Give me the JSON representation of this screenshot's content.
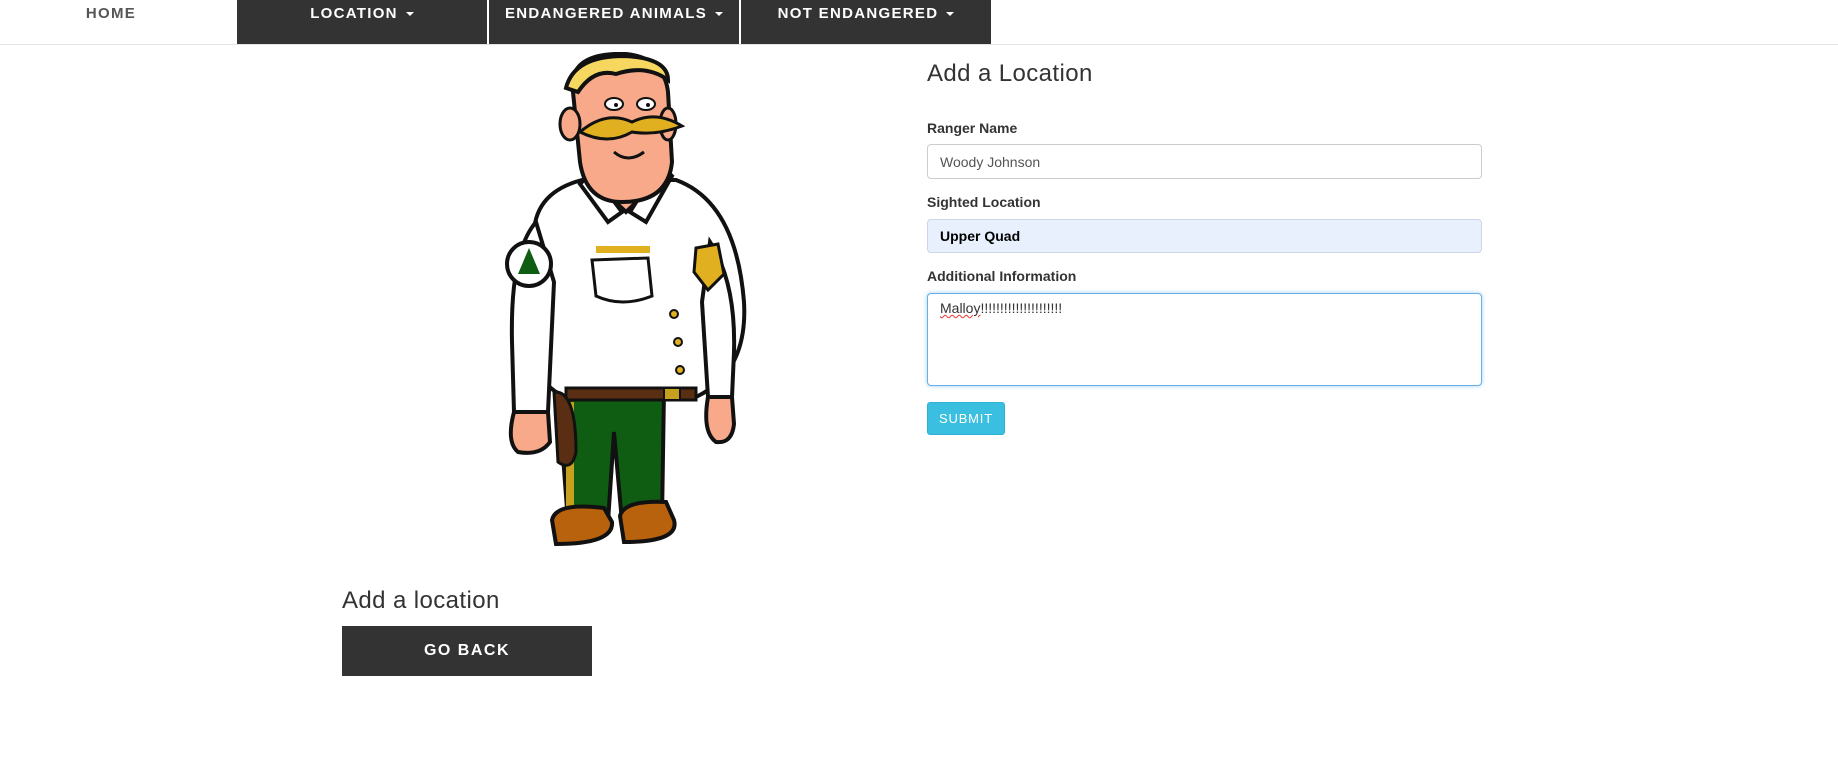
{
  "nav": {
    "home": "HOME",
    "location": "LOCATION",
    "endangered": "ENDANGERED ANIMALS",
    "not_endangered": "NOT ENDANGERED"
  },
  "page": {
    "subtitle": "Add a location",
    "go_back": "GO BACK"
  },
  "form": {
    "title": "Add a Location",
    "ranger_label": "Ranger Name",
    "ranger_value": "Woody Johnson",
    "location_label": "Sighted Location",
    "location_value": "Upper Quad",
    "info_label": "Additional Information",
    "info_value_word": "Malloy",
    "info_value_rest": "!!!!!!!!!!!!!!!!!!!!!",
    "submit": "SUBMIT"
  },
  "colors": {
    "nav_dark": "#333333",
    "submit": "#3bbfe0",
    "autofill": "#e8f0fe",
    "focus": "#66afe9"
  }
}
